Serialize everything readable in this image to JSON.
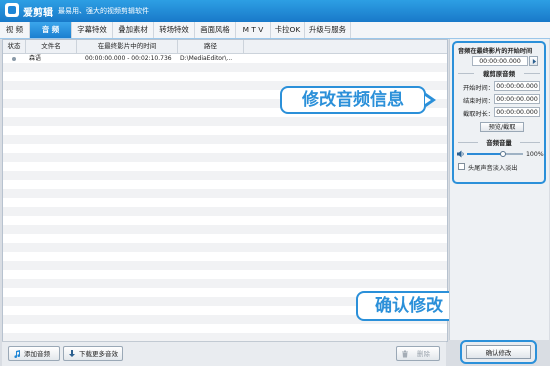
{
  "app": {
    "name": "爱剪辑",
    "slogan": "最易用、强大的视频剪辑软件"
  },
  "tabs": [
    {
      "label": "视  频",
      "active": false
    },
    {
      "label": "音  频",
      "active": true
    },
    {
      "label": "字幕特效",
      "active": false
    },
    {
      "label": "叠加素材",
      "active": false
    },
    {
      "label": "转场特效",
      "active": false
    },
    {
      "label": "画面风格",
      "active": false
    },
    {
      "label": "M T V",
      "active": false
    },
    {
      "label": "卡拉OK",
      "active": false
    },
    {
      "label": "升级与服务",
      "active": false
    }
  ],
  "table": {
    "columns": [
      "状态",
      "文件名",
      "在最终影片中的时间",
      "路径"
    ],
    "rows": [
      {
        "filename": "森语",
        "time": "00:00:00.000 - 00:02:10.736",
        "path": "D:\\MediaEditor\\..."
      }
    ]
  },
  "bottom": {
    "add_audio": "添加音频",
    "download_more": "下载更多音效",
    "delete": "删除"
  },
  "right": {
    "start_label": "音频在最终影片的开始时间",
    "start_time": "00:00:00.000",
    "clip_section": "裁剪原音频",
    "clip_start_label": "开始时间：",
    "clip_start_value": "00:00:00.000",
    "clip_end_label": "结束时间：",
    "clip_end_value": "00:00:00.000",
    "clip_duration_label": "截取时长：",
    "clip_duration_value": "00:00:00.000",
    "preview_button": "预览/截取",
    "volume_section": "音频音量",
    "volume_value": "100%",
    "volume_level": 1.0,
    "fade_label": "头尾声音淡入淡出",
    "confirm_button": "确认修改"
  },
  "callouts": {
    "edit_audio_info": "修改音频信息",
    "confirm_edit": "确认修改"
  },
  "colors": {
    "accent": "#2b90d9",
    "titlebar": "#1f86d6"
  }
}
